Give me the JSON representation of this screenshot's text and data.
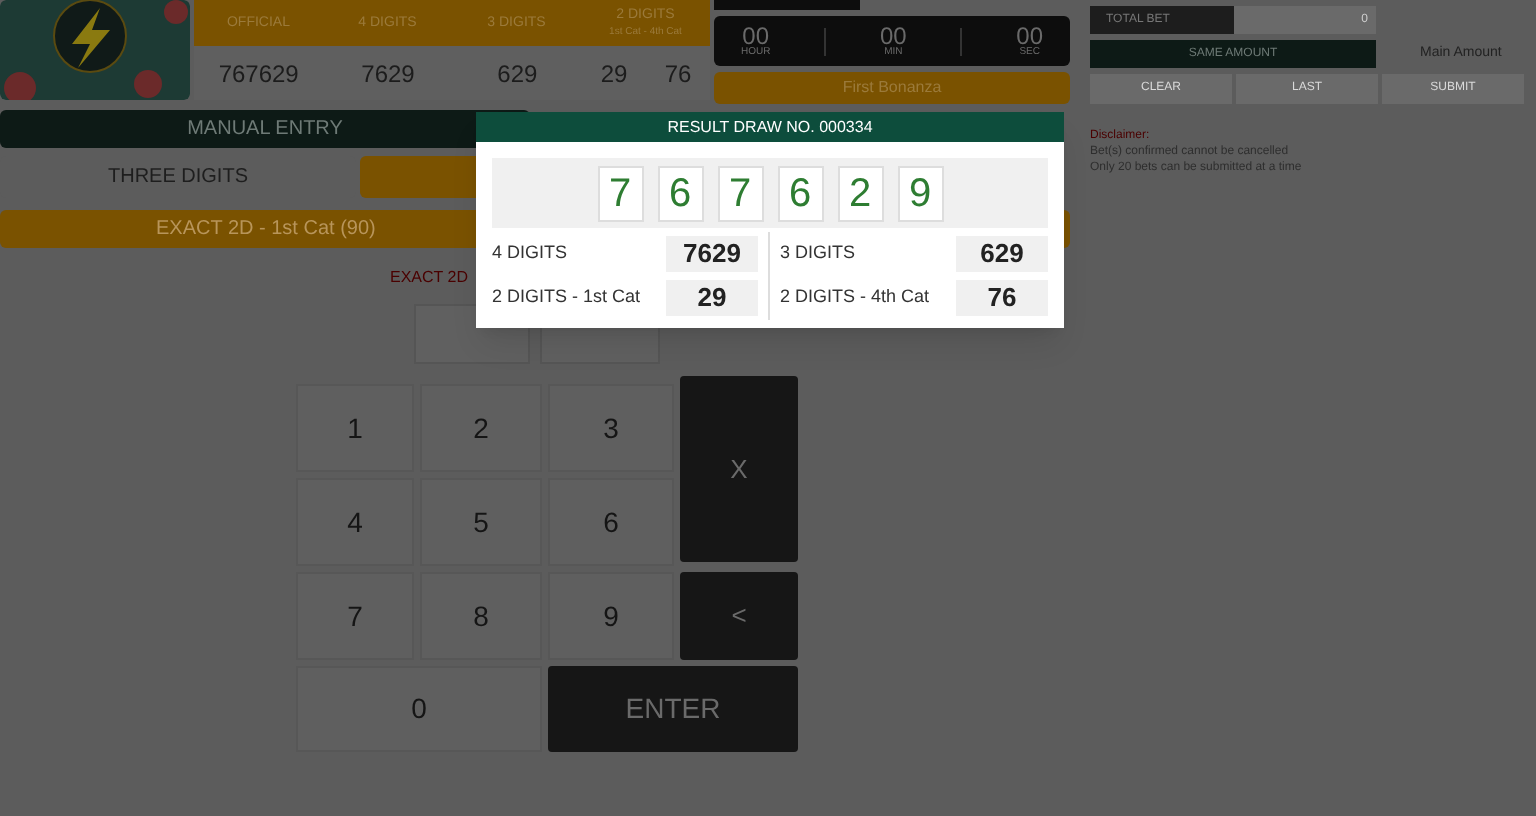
{
  "results_table": {
    "columns": [
      "OFFICIAL",
      "4 DIGITS",
      "3 DIGITS",
      "2 DIGITS"
    ],
    "subheading": "1st Cat - 4th Cat",
    "values": [
      "767629",
      "7629",
      "629",
      "29",
      "76"
    ]
  },
  "timer": [
    {
      "value": "00",
      "unit": "HOUR"
    },
    {
      "value": "00",
      "unit": "MIN"
    },
    {
      "value": "00",
      "unit": "SEC"
    }
  ],
  "bonanza_button": "First Bonanza",
  "entry_bar": "MANUAL ENTRY",
  "tabs": [
    {
      "label": "THREE DIGITS",
      "selected": false
    },
    {
      "selected": true
    }
  ],
  "bet_type": "EXACT 2D - 1st Cat (90)",
  "bet_label": "EXACT 2D",
  "keypad": [
    {
      "label": "1",
      "kind": "key"
    },
    {
      "label": "2",
      "kind": "key"
    },
    {
      "label": "3",
      "kind": "key"
    },
    {
      "label": "X",
      "kind": "action"
    },
    {
      "label": "4",
      "kind": "key"
    },
    {
      "label": "5",
      "kind": "key"
    },
    {
      "label": "6",
      "kind": "key"
    },
    {
      "label": "7",
      "kind": "key"
    },
    {
      "label": "8",
      "kind": "key"
    },
    {
      "label": "9",
      "kind": "key"
    },
    {
      "label": "<",
      "kind": "action"
    },
    {
      "label": "0",
      "kind": "key"
    },
    {
      "label": "ENTER",
      "kind": "action"
    }
  ],
  "total_bet": {
    "label": "TOTAL BET",
    "value": "0"
  },
  "same_amount": "SAME AMOUNT",
  "main_amount": "Main Amount",
  "actions": [
    "CLEAR",
    "LAST",
    "SUBMIT"
  ],
  "disclaimer": {
    "title": "Disclaimer:",
    "lines": [
      "Bet(s) confirmed cannot be cancelled",
      "Only 20 bets can be submitted at a time"
    ]
  },
  "result_dialog": {
    "title": "RESULT DRAW NO. 000334",
    "digits": [
      "7",
      "6",
      "7",
      "6",
      "2",
      "9"
    ],
    "stats": [
      {
        "label": "4 DIGITS",
        "value": "7629"
      },
      {
        "label": "3 DIGITS",
        "value": "629"
      },
      {
        "label": "2 DIGITS - 1st Cat",
        "value": "29"
      },
      {
        "label": "2 DIGITS - 4th Cat",
        "value": "76"
      }
    ]
  }
}
